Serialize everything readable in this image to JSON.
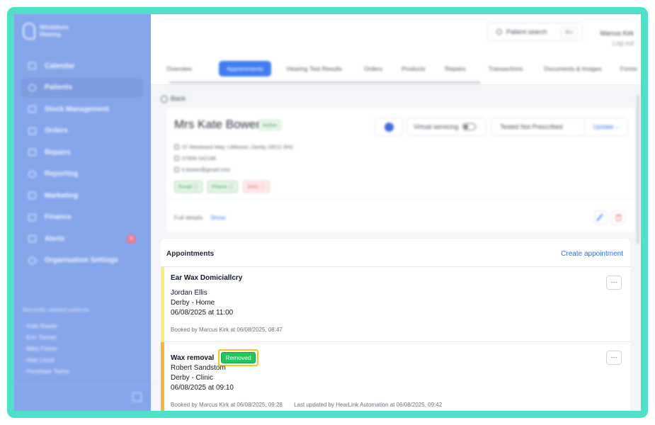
{
  "brand": {
    "name": "Windsbury\nHearing"
  },
  "sidebar": {
    "items": [
      {
        "label": "Calendar",
        "icon": "calendar-icon"
      },
      {
        "label": "Patients",
        "icon": "patients-icon"
      },
      {
        "label": "Stock Management",
        "icon": "stock-icon"
      },
      {
        "label": "Orders",
        "icon": "orders-icon"
      },
      {
        "label": "Repairs",
        "icon": "wrench-icon"
      },
      {
        "label": "Reporting",
        "icon": "chart-icon"
      },
      {
        "label": "Marketing",
        "icon": "mail-icon"
      },
      {
        "label": "Finance",
        "icon": "card-icon"
      },
      {
        "label": "Alerts",
        "icon": "bell-icon",
        "badge": "5"
      },
      {
        "label": "Organisation Settings",
        "icon": "gear-icon"
      }
    ],
    "active_item": "Patients",
    "recent_title": "Recently viewed patients",
    "recent": [
      "- Kate Bower",
      "- Eric Tanner",
      "- Mike Fisher",
      "- Alan Lloyd",
      "- Penelope Twine"
    ]
  },
  "header": {
    "search_label": "Patient search",
    "search_shortcut": "⌘K",
    "user_name": "Marcus Kirk",
    "logout": "Log out"
  },
  "tabs": [
    {
      "label": "Overview"
    },
    {
      "label": "Appointments",
      "active": true
    },
    {
      "label": "Hearing Test Results"
    },
    {
      "label": "Orders"
    },
    {
      "label": "Products"
    },
    {
      "label": "Repairs"
    },
    {
      "label": "Transactions"
    },
    {
      "label": "Documents & Images"
    },
    {
      "label": "Forms"
    }
  ],
  "back_label": "Back",
  "patient": {
    "name": "Mrs Kate Bower",
    "status": "Active",
    "address": "37 Westward Way, Littleover, Derby, DE22 3HC",
    "phone": "07806 542199",
    "email": "k.bower@gmail.com",
    "consents": [
      {
        "label": "Email ⓘ",
        "ok": true
      },
      {
        "label": "Phone ⓘ",
        "ok": true
      },
      {
        "label": "SMS ⓘ",
        "ok": false
      }
    ],
    "virtual_servicing_label": "Virtual servicing",
    "prescription_status": "Tested Not Prescribed",
    "update_label": "Update ⌵",
    "full_details_label": "Full details",
    "show_label": "Show"
  },
  "appointments": {
    "title": "Appointments",
    "create_label": "Create appointment",
    "items": [
      {
        "title": "Ear Wax Domiciallcry",
        "person": "Jordan Ellis",
        "location": "Derby - Home",
        "datetime": "06/08/2025 at 11:00",
        "booked": "Booked by Marcus Kirk at 06/08/2025, 08:47",
        "accent": "#f7ec7a"
      },
      {
        "title": "Wax removal",
        "badge": "Removed",
        "person": "Robert Sandstom",
        "location": "Derby - Clinic",
        "datetime": "06/08/2025 at 09:10",
        "booked": "Booked by Marcus Kirk at 06/08/2025, 09:28",
        "updated": "Last updated by HearLink Automation at 06/08/2025, 09:42",
        "accent": "#f5b73b"
      }
    ],
    "more_label": "···"
  },
  "colors": {
    "frame": "#4fe0c9",
    "sidebar": "#86a6ec",
    "primary": "#3f7df0",
    "removed": "#22c55e",
    "highlight": "#f5c518"
  }
}
